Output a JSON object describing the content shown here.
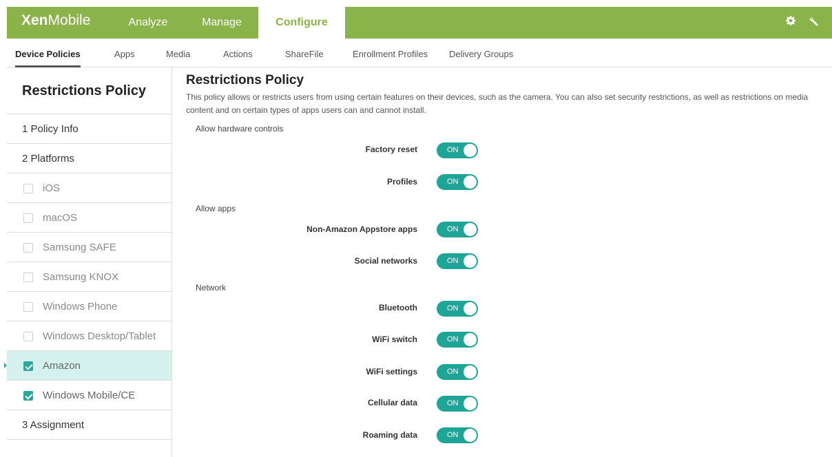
{
  "app": {
    "logo_bold": "Xen",
    "logo_light": "Mobile"
  },
  "nav": {
    "tabs": [
      {
        "label": "Analyze"
      },
      {
        "label": "Manage"
      },
      {
        "label": "Configure"
      }
    ],
    "icons": [
      "gear-icon",
      "wrench-icon"
    ]
  },
  "subnav": {
    "tabs": [
      {
        "label": "Device Policies"
      },
      {
        "label": "Apps"
      },
      {
        "label": "Media"
      },
      {
        "label": "Actions"
      },
      {
        "label": "ShareFile"
      },
      {
        "label": "Enrollment Profiles"
      },
      {
        "label": "Delivery Groups"
      }
    ]
  },
  "sidebar": {
    "title": "Restrictions Policy",
    "step1": "1  Policy Info",
    "step2": "2  Platforms",
    "step3": "3  Assignment",
    "platforms": [
      {
        "label": "iOS",
        "checked": false
      },
      {
        "label": "macOS",
        "checked": false
      },
      {
        "label": "Samsung SAFE",
        "checked": false
      },
      {
        "label": "Samsung KNOX",
        "checked": false
      },
      {
        "label": "Windows Phone",
        "checked": false
      },
      {
        "label": "Windows Desktop/Tablet",
        "checked": false
      },
      {
        "label": "Amazon",
        "checked": true
      },
      {
        "label": "Windows Mobile/CE",
        "checked": true
      }
    ]
  },
  "main": {
    "title": "Restrictions Policy",
    "description": "This policy allows or restricts users from using certain features on their devices, such as the camera. You can also set security restrictions, as well as restrictions on media content and on certain types of apps users can and cannot install.",
    "sections": [
      {
        "heading": "Allow hardware controls",
        "rows": [
          {
            "label": "Factory reset",
            "value": "ON"
          },
          {
            "label": "Profiles",
            "value": "ON"
          }
        ]
      },
      {
        "heading": "Allow apps",
        "rows": [
          {
            "label": "Non-Amazon Appstore apps",
            "value": "ON"
          },
          {
            "label": "Social networks",
            "value": "ON"
          }
        ]
      },
      {
        "heading": "Network",
        "rows": [
          {
            "label": "Bluetooth",
            "value": "ON"
          },
          {
            "label": "WiFi switch",
            "value": "ON"
          },
          {
            "label": "WiFi settings",
            "value": "ON"
          },
          {
            "label": "Cellular data",
            "value": "ON"
          },
          {
            "label": "Roaming data",
            "value": "ON"
          }
        ]
      }
    ]
  },
  "colors": {
    "brand": "#8ab449",
    "toggle_on": "#1ea597",
    "selected_bg": "#d5f1ee"
  }
}
